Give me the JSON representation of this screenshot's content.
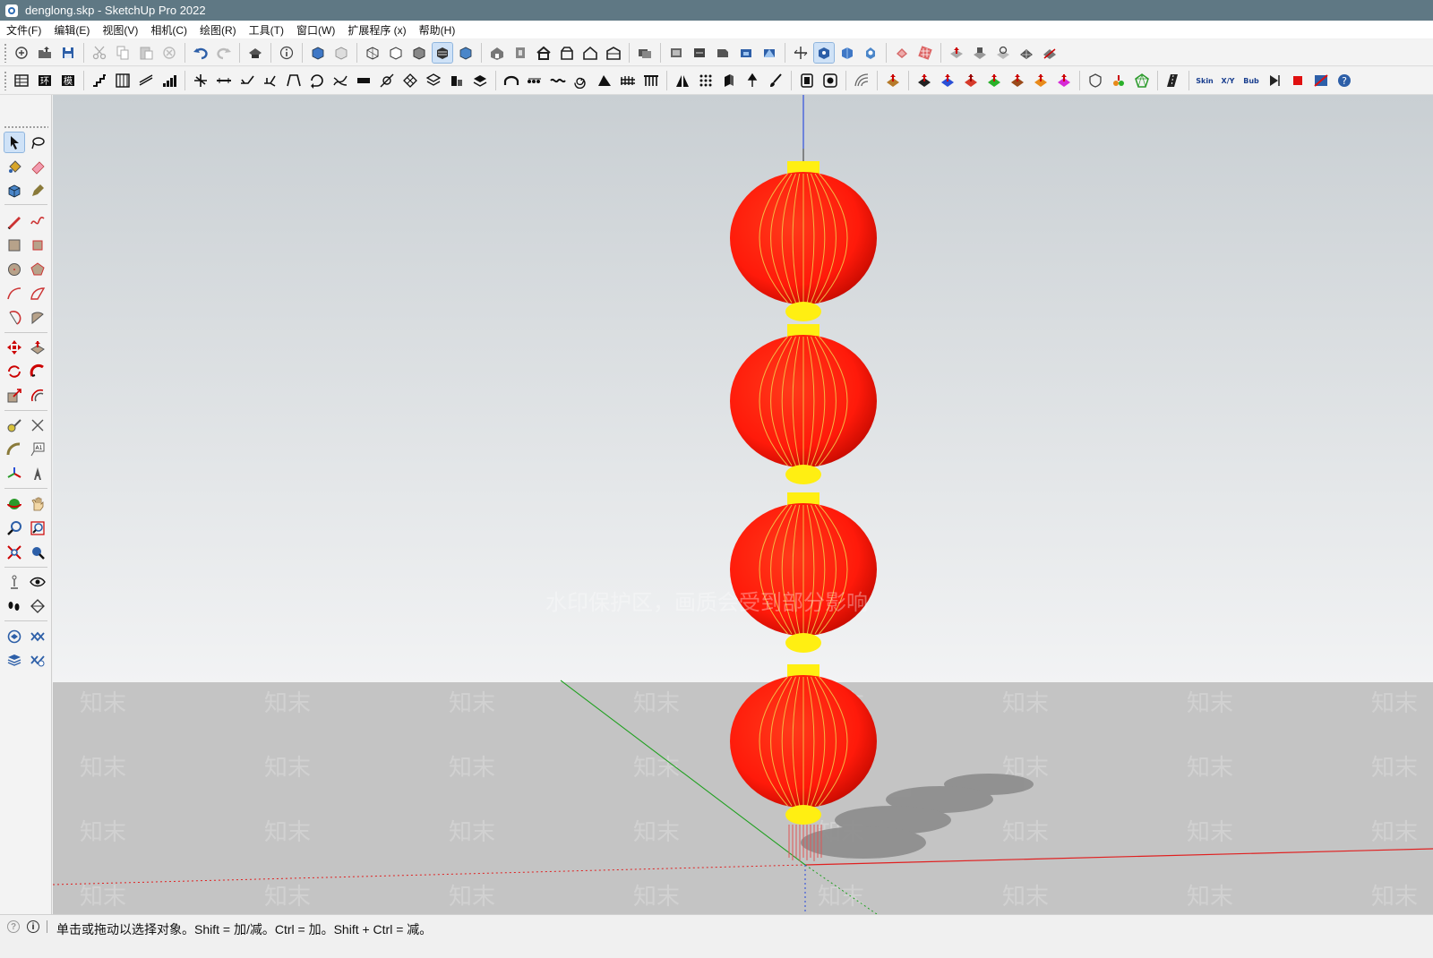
{
  "window": {
    "title": "denglong.skp - SketchUp Pro 2022"
  },
  "menubar": {
    "items": [
      "文件(F)",
      "编辑(E)",
      "视图(V)",
      "相机(C)",
      "绘图(R)",
      "工具(T)",
      "窗口(W)",
      "扩展程序 (x)",
      "帮助(H)"
    ]
  },
  "toolbar_labels": {
    "skin": "Skin",
    "xy": "X/Y",
    "bub": "Bub"
  },
  "viewport": {
    "sky_top": "#c9cfd3",
    "sky_bottom": "#f2f3f4",
    "ground": "#c4c4c4",
    "lantern_red": "#ff1a0a",
    "lantern_cap": "#ffef12",
    "lantern_count": 4,
    "watermark_line": "水印保护区，画质会受到部分影响",
    "watermark_brand": "知末"
  },
  "status": {
    "message": "单击或拖动以选择对象。Shift = 加/减。Ctrl = 加。Shift + Ctrl = 减。",
    "icon_hint": "?",
    "icon_info": "i"
  },
  "colors": {
    "titlebar": "#5f7884",
    "active_tool": "#cfe2f7"
  }
}
